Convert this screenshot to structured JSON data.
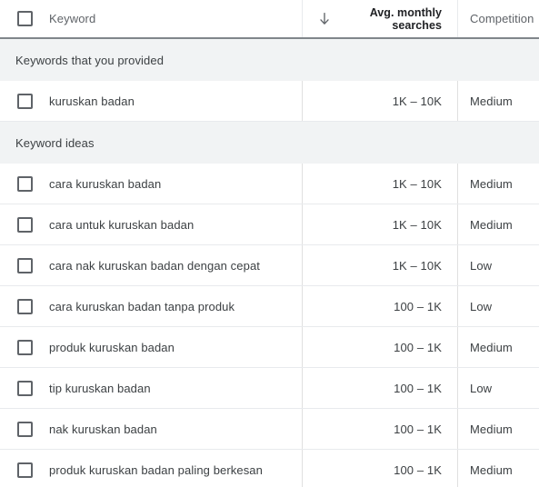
{
  "table": {
    "columns": {
      "select_all_checkbox": "select-all",
      "keyword_header": "Keyword",
      "sort_icon": "arrow-down-icon",
      "volume_header_line1": "Avg. monthly",
      "volume_header_line2": "searches",
      "competition_header": "Competition"
    },
    "sections": [
      {
        "label": "Keywords that you provided",
        "rows": [
          {
            "keyword": "kuruskan badan",
            "volume": "1K – 10K",
            "competition": "Medium"
          }
        ]
      },
      {
        "label": "Keyword ideas",
        "rows": [
          {
            "keyword": "cara kuruskan badan",
            "volume": "1K – 10K",
            "competition": "Medium"
          },
          {
            "keyword": "cara untuk kuruskan badan",
            "volume": "1K – 10K",
            "competition": "Medium"
          },
          {
            "keyword": "cara nak kuruskan badan dengan cepat",
            "volume": "1K – 10K",
            "competition": "Low"
          },
          {
            "keyword": "cara kuruskan badan tanpa produk",
            "volume": "100 – 1K",
            "competition": "Low"
          },
          {
            "keyword": "produk kuruskan badan",
            "volume": "100 – 1K",
            "competition": "Medium"
          },
          {
            "keyword": "tip kuruskan badan",
            "volume": "100 – 1K",
            "competition": "Low"
          },
          {
            "keyword": "nak kuruskan badan",
            "volume": "100 – 1K",
            "competition": "Medium"
          },
          {
            "keyword": "produk kuruskan badan paling berkesan",
            "volume": "100 – 1K",
            "competition": "Medium"
          }
        ]
      }
    ]
  }
}
